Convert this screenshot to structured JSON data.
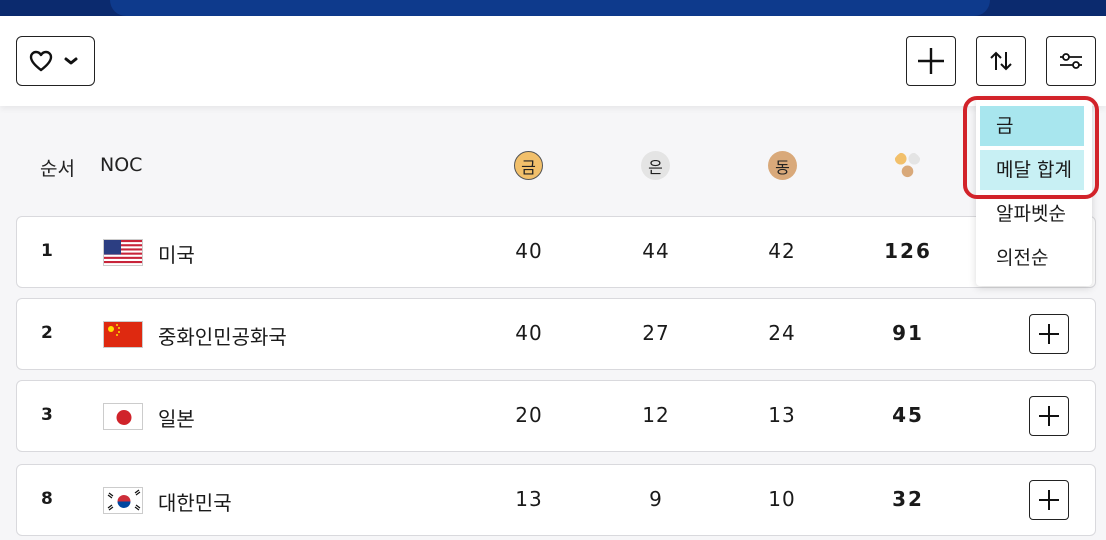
{
  "header": {
    "rank_label": "순서",
    "noc_label": "NOC",
    "gold_label": "금",
    "silver_label": "은",
    "bronze_label": "동"
  },
  "toolbar": {
    "favorite_icon": "heart-icon",
    "dropdown_icon": "chevron-down-icon",
    "add_icon": "plus-icon",
    "sort_icon": "sort-arrows-icon",
    "filter_icon": "sliders-icon"
  },
  "rows": [
    {
      "rank": "1",
      "country": "미국",
      "flag": "usa",
      "gold": "40",
      "silver": "44",
      "bronze": "42",
      "total": "126"
    },
    {
      "rank": "2",
      "country": "중화인민공화국",
      "flag": "china",
      "gold": "40",
      "silver": "27",
      "bronze": "24",
      "total": "91"
    },
    {
      "rank": "3",
      "country": "일본",
      "flag": "japan",
      "gold": "20",
      "silver": "12",
      "bronze": "13",
      "total": "45"
    },
    {
      "rank": "8",
      "country": "대한민국",
      "flag": "korea",
      "gold": "13",
      "silver": "9",
      "bronze": "10",
      "total": "32"
    }
  ],
  "sort_menu": {
    "items": [
      "금",
      "메달 합계",
      "알파벳순",
      "의전순"
    ]
  },
  "colors": {
    "gold": "#f2c06b",
    "silver": "#e4e4e4",
    "bronze": "#d9a97a",
    "highlight": "#a8e6ee",
    "ring": "#d2232a"
  }
}
